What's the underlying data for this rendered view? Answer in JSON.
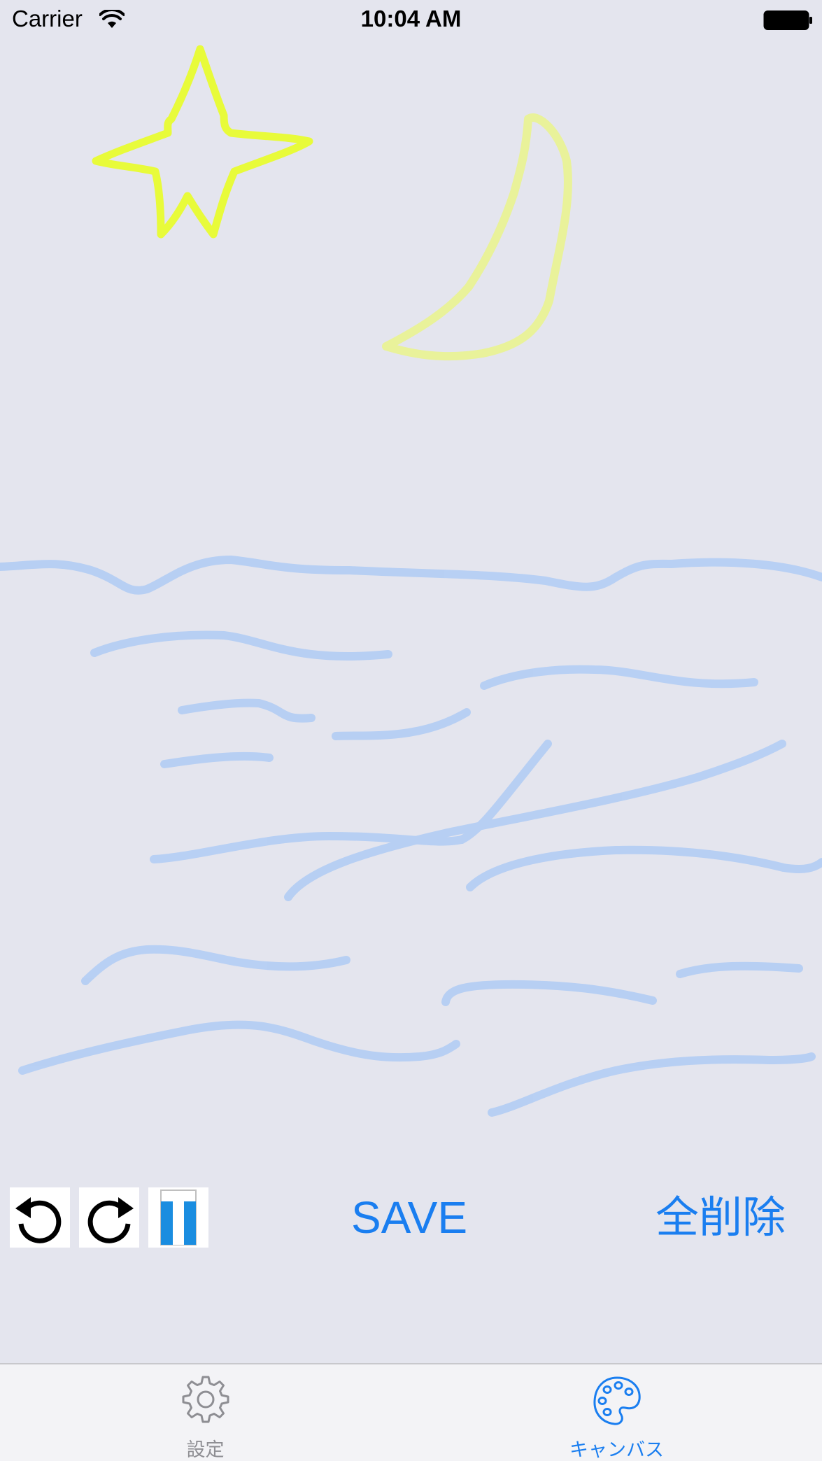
{
  "status_bar": {
    "carrier": "Carrier",
    "time": "10:04 AM"
  },
  "toolbar": {
    "save_label": "SAVE",
    "clear_label": "全削除",
    "undo_icon": "undo-icon",
    "redo_icon": "redo-icon",
    "eraser_icon": "eraser-icon"
  },
  "tab_bar": {
    "tabs": [
      {
        "label": "設定",
        "icon": "gear-icon",
        "selected": false
      },
      {
        "label": "キャンバス",
        "icon": "palette-icon",
        "selected": true
      }
    ]
  },
  "colors": {
    "background": "#e4e5ee",
    "accent": "#1a7ef0",
    "star_stroke": "#e8fb3a",
    "moon_stroke": "#e9f29a",
    "wave_stroke": "#a9c8f5",
    "tab_inactive": "#8e8e93"
  }
}
